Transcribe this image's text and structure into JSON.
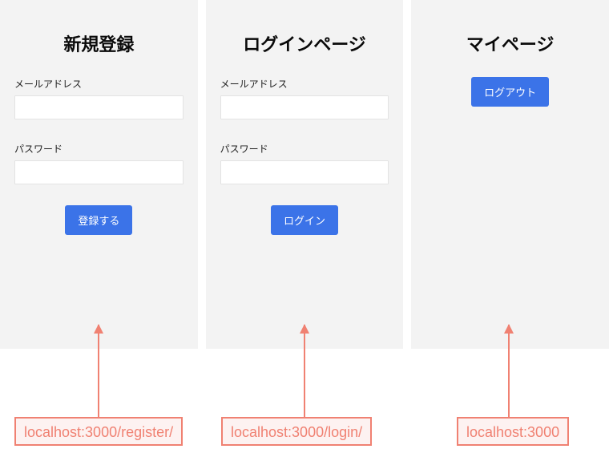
{
  "panels": {
    "register": {
      "title": "新規登録",
      "email_label": "メールアドレス",
      "email_value": "",
      "password_label": "パスワード",
      "password_value": "",
      "submit_label": "登録する",
      "url": "localhost:3000/register/"
    },
    "login": {
      "title": "ログインページ",
      "email_label": "メールアドレス",
      "email_value": "",
      "password_label": "パスワード",
      "password_value": "",
      "submit_label": "ログイン",
      "url": "localhost:3000/login/"
    },
    "mypage": {
      "title": "マイページ",
      "logout_label": "ログアウト",
      "url": "localhost:3000"
    }
  },
  "colors": {
    "primary_button": "#3b73e8",
    "annotation": "#f08172",
    "panel_bg": "#f3f3f3"
  }
}
